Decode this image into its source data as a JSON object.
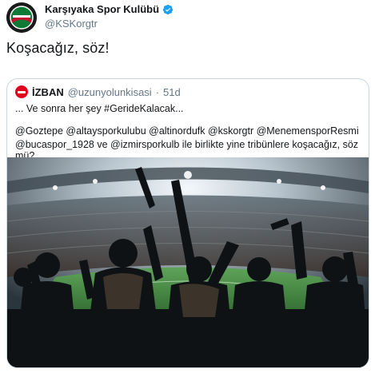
{
  "tweet": {
    "display_name": "Karşıyaka Spor Kulübü",
    "handle": "@KSKorgtr",
    "text": "Koşacağız, söz!",
    "verified_icon": "verified-badge-icon",
    "avatar_icon": "karsiyaka-crest-icon"
  },
  "quoted_tweet": {
    "display_name": "İZBAN",
    "handle": "@uzunyolunkisasi",
    "dot": "·",
    "time": "51d",
    "line1": "... Ve sonra her şey #GerideKalacak...",
    "line2": "@Goztepe @altaysporkulubu @altinordufk @kskorgtr @MenemensporResmi",
    "line3": "@bucaspor_1928 ve @izmirsporkulb ile birlikte yine tribünlere koşacağız, söz mü?",
    "image_description_icon": "stadium-crowd-photo"
  },
  "colors": {
    "text_primary": "#14171a",
    "text_secondary": "#657786",
    "border": "#ccd6dd",
    "verified_blue": "#1da1f2",
    "izban_red": "#e2001a"
  }
}
